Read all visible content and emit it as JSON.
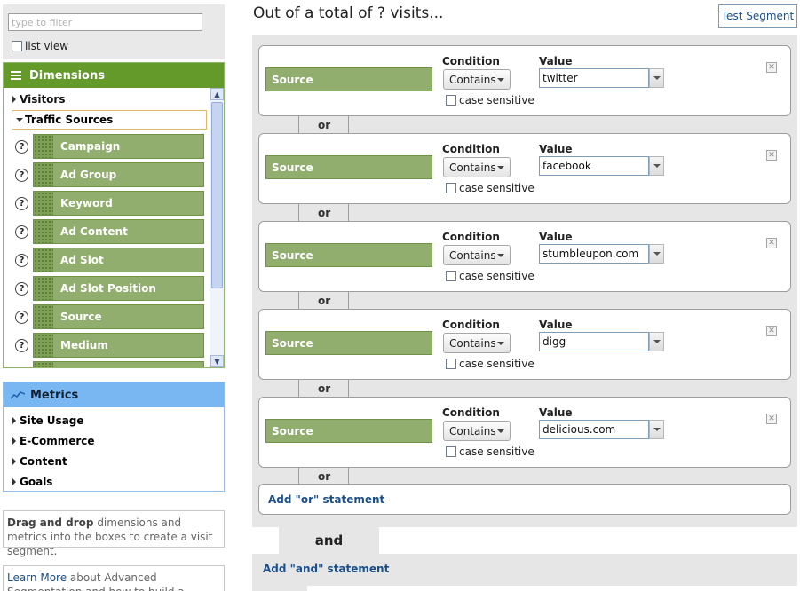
{
  "filter": {
    "placeholder": "type to filter",
    "list_view_label": "list view"
  },
  "dimensions": {
    "header": "Dimensions",
    "groups": [
      {
        "label": "Visitors",
        "expanded": false
      },
      {
        "label": "Traffic Sources",
        "expanded": true
      }
    ],
    "items": [
      "Campaign",
      "Ad Group",
      "Keyword",
      "Ad Content",
      "Ad Slot",
      "Ad Slot Position",
      "Source",
      "Medium"
    ],
    "help_glyph": "?"
  },
  "metrics": {
    "header": "Metrics",
    "items": [
      "Site Usage",
      "E-Commerce",
      "Content",
      "Goals"
    ]
  },
  "help_text": {
    "bold": "Drag and drop",
    "rest": " dimensions and metrics into the boxes to create a visit segment."
  },
  "learn_text": {
    "link": "Learn More",
    "rest": " about Advanced Segmentation and how to build a custom"
  },
  "main": {
    "title": "Out of a total of ? visits...",
    "test_segment_label": "Test Segment",
    "condition_label": "Condition",
    "value_label": "Value",
    "case_label": "case sensitive",
    "or_label": "or",
    "add_or_label": "Add \"or\" statement",
    "and_label": "and",
    "add_and_label": "Add \"and\" statement",
    "delete_glyph": "✕",
    "conditions": [
      {
        "dimension": "Source",
        "operator": "Contains",
        "value": "twitter"
      },
      {
        "dimension": "Source",
        "operator": "Contains",
        "value": "facebook"
      },
      {
        "dimension": "Source",
        "operator": "Contains",
        "value": "stumbleupon.com"
      },
      {
        "dimension": "Source",
        "operator": "Contains",
        "value": "digg"
      },
      {
        "dimension": "Source",
        "operator": "Contains",
        "value": "delicious.com"
      }
    ]
  },
  "colors": {
    "dimension_header": "#649a2a",
    "dimension_chip": "#92ae6f",
    "metrics_header": "#79b7f3",
    "link": "#1a4f8a",
    "segment_bg": "#e6e6e6"
  }
}
